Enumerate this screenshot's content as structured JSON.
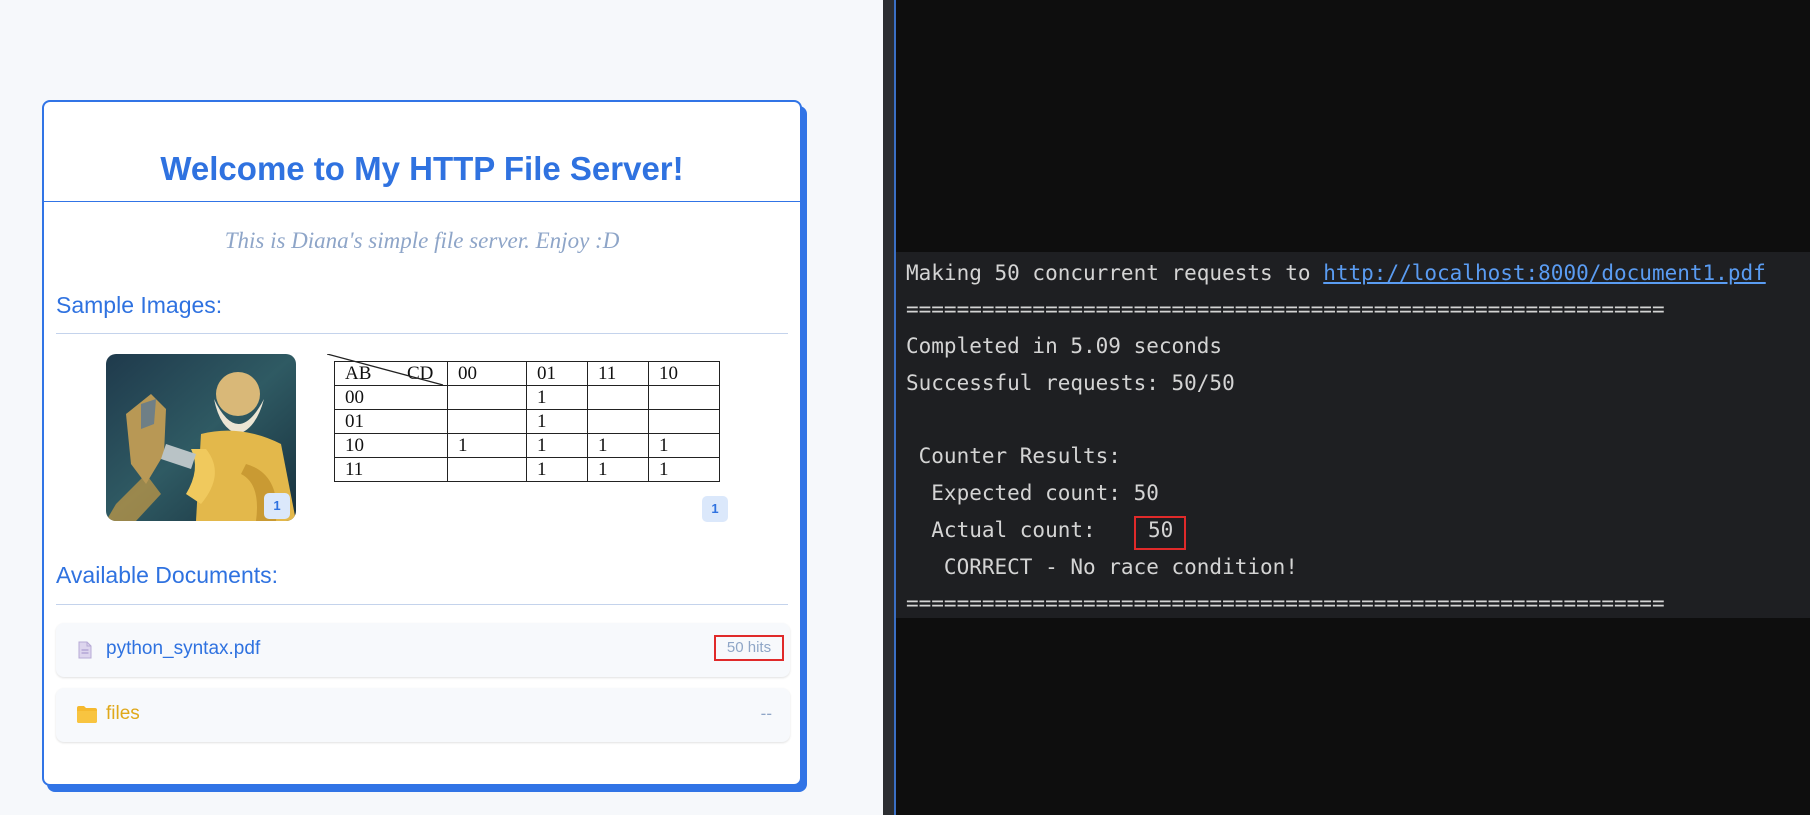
{
  "page": {
    "title": "Welcome to My HTTP File Server!",
    "subtitle": "This is Diana's simple file server. Enjoy :D",
    "images_heading": "Sample Images:",
    "images": [
      {
        "icon": "statue-artwork-image",
        "badge": "1"
      },
      {
        "icon": "karnaugh-map-image",
        "badge": "1"
      }
    ],
    "kmap": {
      "corner_row": "AB",
      "corner_col": "CD",
      "col_headers": [
        "00",
        "01",
        "11",
        "10"
      ],
      "rows": [
        {
          "label": "00",
          "cells": [
            "",
            "1",
            "",
            ""
          ]
        },
        {
          "label": "01",
          "cells": [
            "",
            "1",
            "",
            ""
          ]
        },
        {
          "label": "10",
          "cells": [
            "1",
            "1",
            "1",
            "1"
          ]
        },
        {
          "label": "11",
          "cells": [
            "",
            "1",
            "1",
            "1"
          ]
        }
      ]
    },
    "documents_heading": "Available Documents:",
    "documents": [
      {
        "name": "python_syntax.pdf",
        "icon": "document-icon",
        "hits": "50 hits",
        "color": "#2f72e0"
      },
      {
        "name": "files",
        "icon": "folder-icon",
        "hits": "--",
        "color": "#e0a81a"
      }
    ]
  },
  "terminal": {
    "line1_prefix": "Making 50 concurrent requests to ",
    "line1_url": "http://localhost:8000/document1.pdf",
    "rule": "============================================================",
    "completed": "Completed in 5.09 seconds",
    "successful": "Successful requests: 50/50",
    "results_heading": " Counter Results:",
    "expected": "  Expected count: 50",
    "actual_label": "  Actual count:",
    "actual_value": "50",
    "verdict": "   CORRECT - No race condition!"
  },
  "colors": {
    "accent": "#3174e6",
    "highlight": "#e02a2a",
    "folder": "#e0a81a",
    "terminal_bg": "#0e0e0e"
  }
}
